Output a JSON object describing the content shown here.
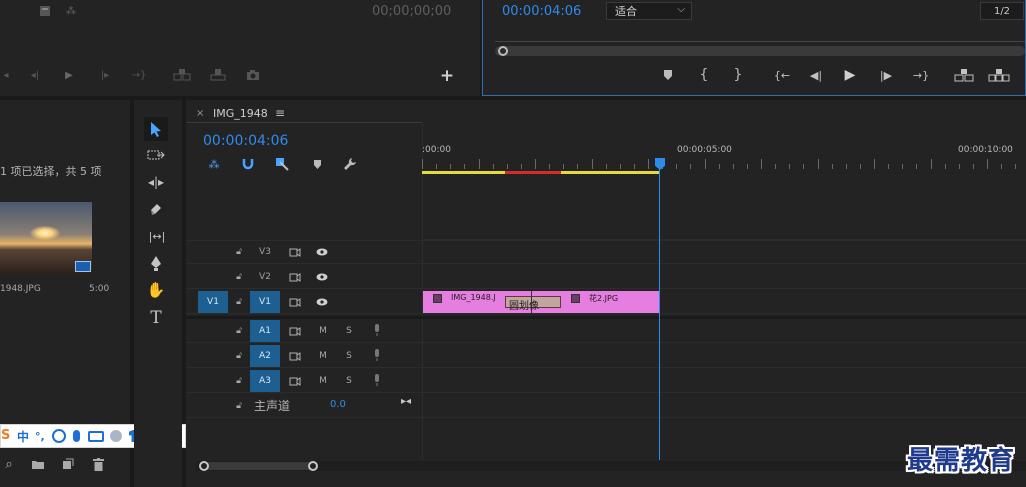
{
  "source_monitor": {
    "timecode": "00;00;00;00"
  },
  "program_monitor": {
    "timecode": "00:00:04:06",
    "zoom_select": "适合",
    "page": "1/2"
  },
  "project": {
    "selection_info": "1 项已选择，共 5 项",
    "clip_name": "1948.JPG",
    "clip_duration": "5:00"
  },
  "ime_bar": {
    "mode": "中",
    "punct": "°,"
  },
  "timeline": {
    "sequence_name": "IMG_1948",
    "timecode": "00:00:04:06",
    "ruler": {
      "t0": ":00:00",
      "t5": "00:00:05:00",
      "t10": "00:00:10:00"
    },
    "tracks": {
      "v3": "V3",
      "v2": "V2",
      "v1": "V1",
      "v1_src": "V1",
      "a1": "A1",
      "a2": "A2",
      "a3": "A3",
      "mute": "M",
      "solo": "S",
      "master_label": "主声道",
      "master_value": "0.0"
    },
    "clips": {
      "clip1": "IMG_1948.J",
      "transition": "圆划像",
      "clip2": "花2.JPG"
    }
  },
  "watermark": "最需教育",
  "colors": {
    "accent": "#2d8ceb",
    "clip": "#e57ee0",
    "track_on": "#1d5f91"
  }
}
